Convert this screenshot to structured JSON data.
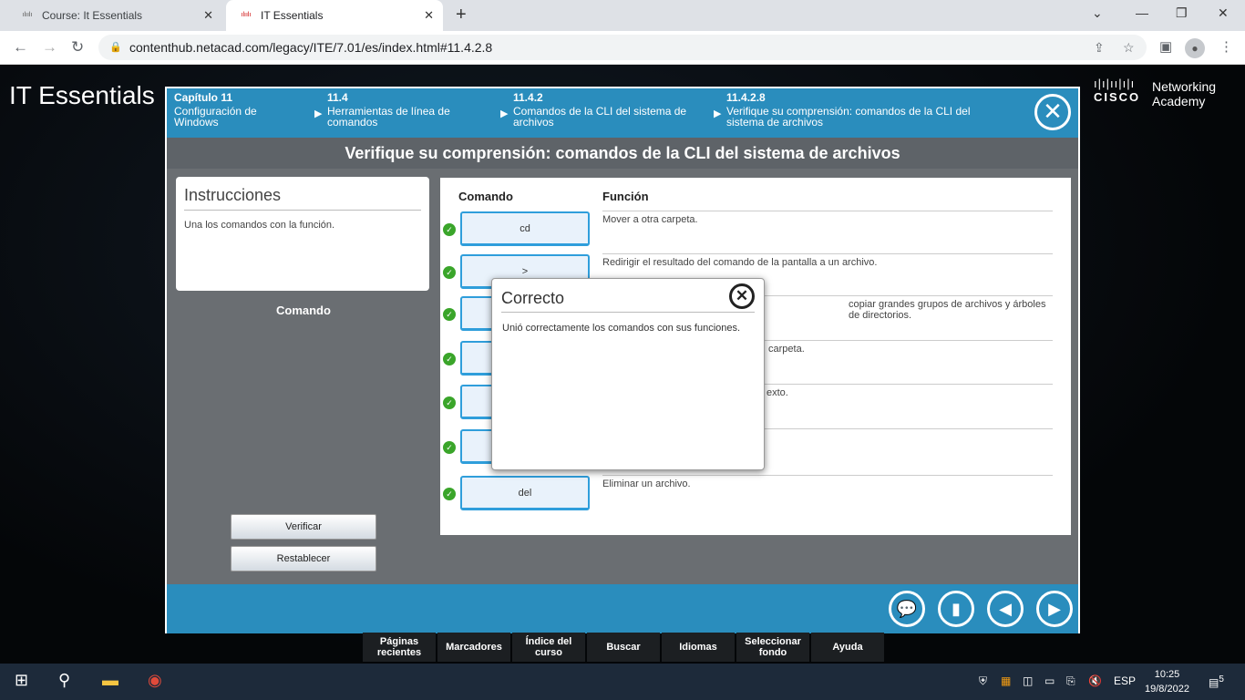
{
  "browser": {
    "tabs": [
      {
        "label": "Course: It Essentials",
        "icon": "cisco-favicon"
      },
      {
        "label": "IT Essentials",
        "icon": "cisco-favicon"
      }
    ],
    "url": "contenthub.netacad.com/legacy/ITE/7.01/es/index.html#11.4.2.8"
  },
  "page": {
    "app_title": "IT Essentials",
    "logo": {
      "brand": "CISCO",
      "text": "Networking Academy"
    }
  },
  "breadcrumbs": [
    {
      "number": "Capítulo 11",
      "title": "Configuración de Windows"
    },
    {
      "number": "11.4",
      "title": "Herramientas de línea de comandos"
    },
    {
      "number": "11.4.2",
      "title": "Comandos de la CLI del sistema de archivos"
    },
    {
      "number": "11.4.2.8",
      "title": "Verifique su comprensión: comandos de la CLI del sistema de archivos"
    }
  ],
  "activity_title": "Verifique su comprensión: comandos de la CLI del sistema de archivos",
  "instructions": {
    "heading": "Instrucciones",
    "text": "Una los comandos con la función."
  },
  "command_label": "Comando",
  "buttons": {
    "verify": "Verificar",
    "reset": "Restablecer"
  },
  "table": {
    "col_command": "Comando",
    "col_function": "Función",
    "rows": [
      {
        "command": "cd",
        "function": "Mover a otra carpeta."
      },
      {
        "command": ">",
        "function": "Redirigir el resultado del comando de la pantalla a un archivo."
      },
      {
        "command": "",
        "function": "copiar grandes grupos de archivos y árboles de directorios."
      },
      {
        "command": "",
        "function": "carpeta."
      },
      {
        "command": "",
        "function": "exto."
      },
      {
        "command": "",
        "function": ""
      },
      {
        "command": "del",
        "function": "Eliminar un archivo."
      }
    ]
  },
  "modal": {
    "title": "Correcto",
    "message": "Unió correctamente los comandos con sus funciones."
  },
  "bottom_menu": [
    "Páginas recientes",
    "Marcadores",
    "Índice del curso",
    "Buscar",
    "Idiomas",
    "Seleccionar fondo",
    "Ayuda"
  ],
  "taskbar": {
    "language": "ESP",
    "time": "10:25",
    "date": "19/8/2022",
    "notifications": "5"
  }
}
